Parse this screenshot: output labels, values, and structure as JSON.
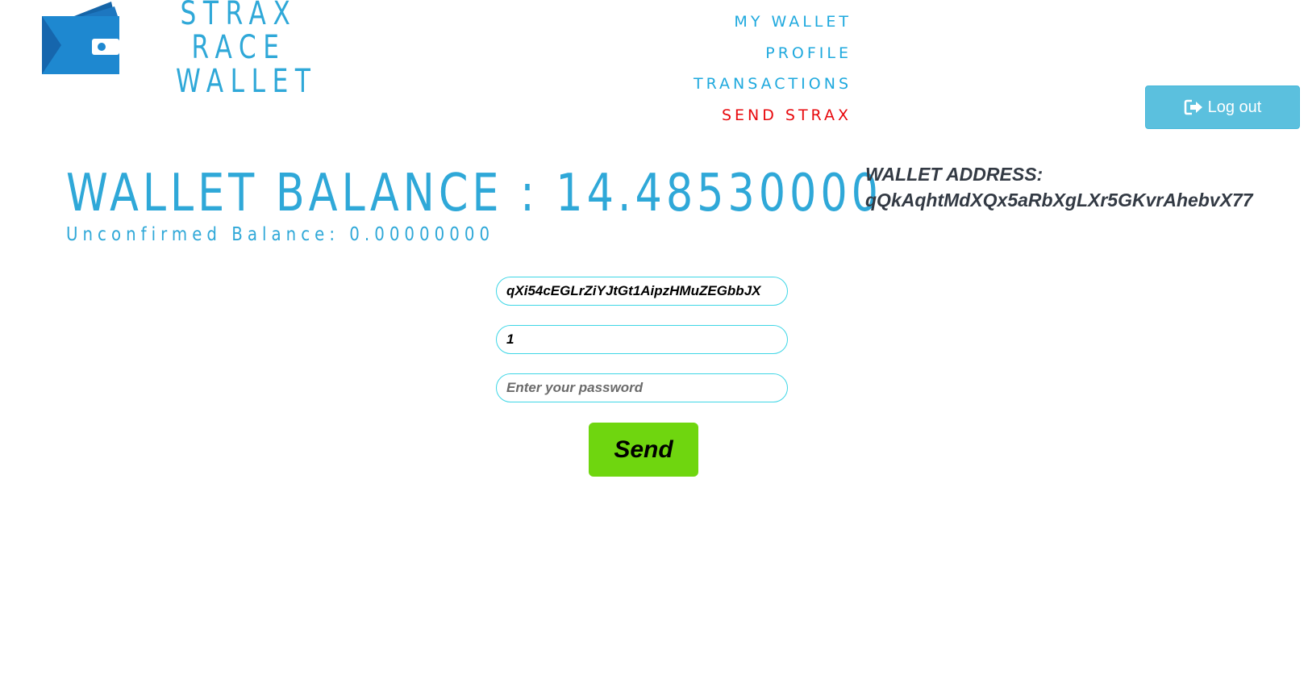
{
  "logo": {
    "lines": [
      "STRAX",
      "RACE",
      "WALLET"
    ]
  },
  "nav": {
    "items": [
      {
        "label": "MY WALLET"
      },
      {
        "label": "PROFILE"
      },
      {
        "label": "TRANSACTIONS"
      },
      {
        "label": "SEND STRAX"
      }
    ],
    "active_color": "#e8090d",
    "color": "#1fa9de"
  },
  "logout": {
    "label": "Log out",
    "icon": "logout-icon"
  },
  "balance": {
    "main": "WALLET BALANCE : 14.48530000",
    "unconfirmed": "Unconfirmed Balance: 0.00000000"
  },
  "wallet_address": {
    "label": "WALLET ADDRESS:",
    "value": "qQkAqhtMdXQx5aRbXgLXr5GKvrAhebvX77"
  },
  "form": {
    "recipient_value": "qXi54cEGLrZiYJtGt1AipzHMuZEGbbJX",
    "amount_value": "1",
    "password_placeholder": "Enter your password",
    "send_label": "Send"
  },
  "colors": {
    "brand": "#2fa8d8",
    "send_button": "#6fd60f",
    "logout_button": "#5bc0de",
    "input_border": "#3ed6e6"
  }
}
